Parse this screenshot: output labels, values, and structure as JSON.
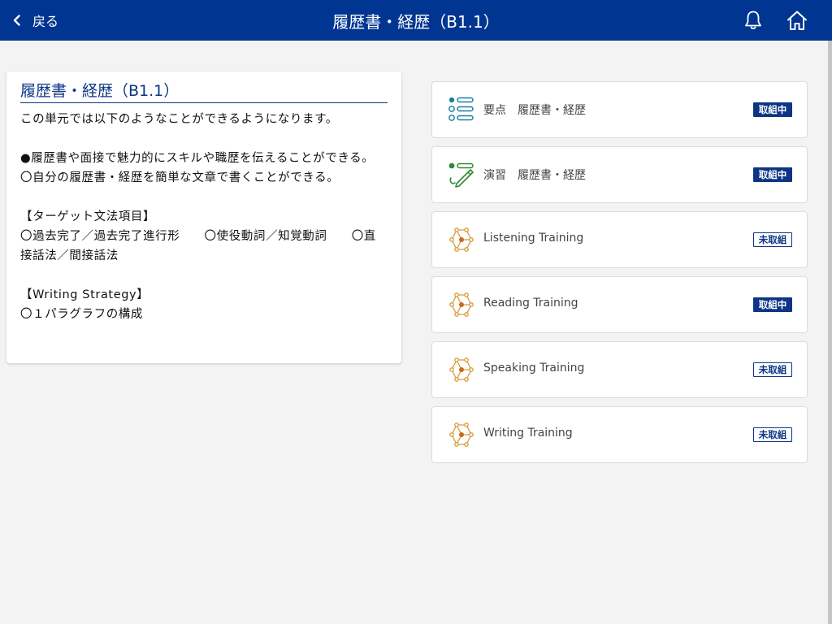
{
  "header": {
    "back_label": "戻る",
    "title": "履歴書・経歴（B1.1）"
  },
  "info": {
    "title": "履歴書・経歴（B1.1）",
    "intro": "この単元では以下のようなことができるようになります。",
    "goal1": "●履歴書や面接で魅力的にスキルや職歴を伝えることができる。",
    "goal2": "〇自分の履歴書・経歴を簡単な文章で書くことができる。",
    "grammar_heading": "【ターゲット文法項目】",
    "grammar_items": "〇過去完了／過去完了進行形　　〇使役動詞／知覚動詞　　〇直接話法／間接話法",
    "strategy_heading": "【Writing Strategy】",
    "strategy_item": "〇１パラグラフの構成"
  },
  "items": [
    {
      "label": "要点　履歴書・経歴",
      "status": "取組中",
      "icon": "list-icon"
    },
    {
      "label": "演習　履歴書・経歴",
      "status": "取組中",
      "icon": "pen-icon"
    },
    {
      "label": "Listening Training",
      "status": "未取組",
      "icon": "molecule-icon"
    },
    {
      "label": "Reading Training",
      "status": "取組中",
      "icon": "molecule-icon"
    },
    {
      "label": "Speaking Training",
      "status": "未取組",
      "icon": "molecule-icon"
    },
    {
      "label": "Writing Training",
      "status": "未取組",
      "icon": "molecule-icon"
    }
  ],
  "colors": {
    "header_bg": "#003591",
    "accent": "#0c3585",
    "list_icon": "#1a7fa0",
    "pen_icon": "#2e8b2e",
    "molecule_icon": "#d89a3a"
  }
}
